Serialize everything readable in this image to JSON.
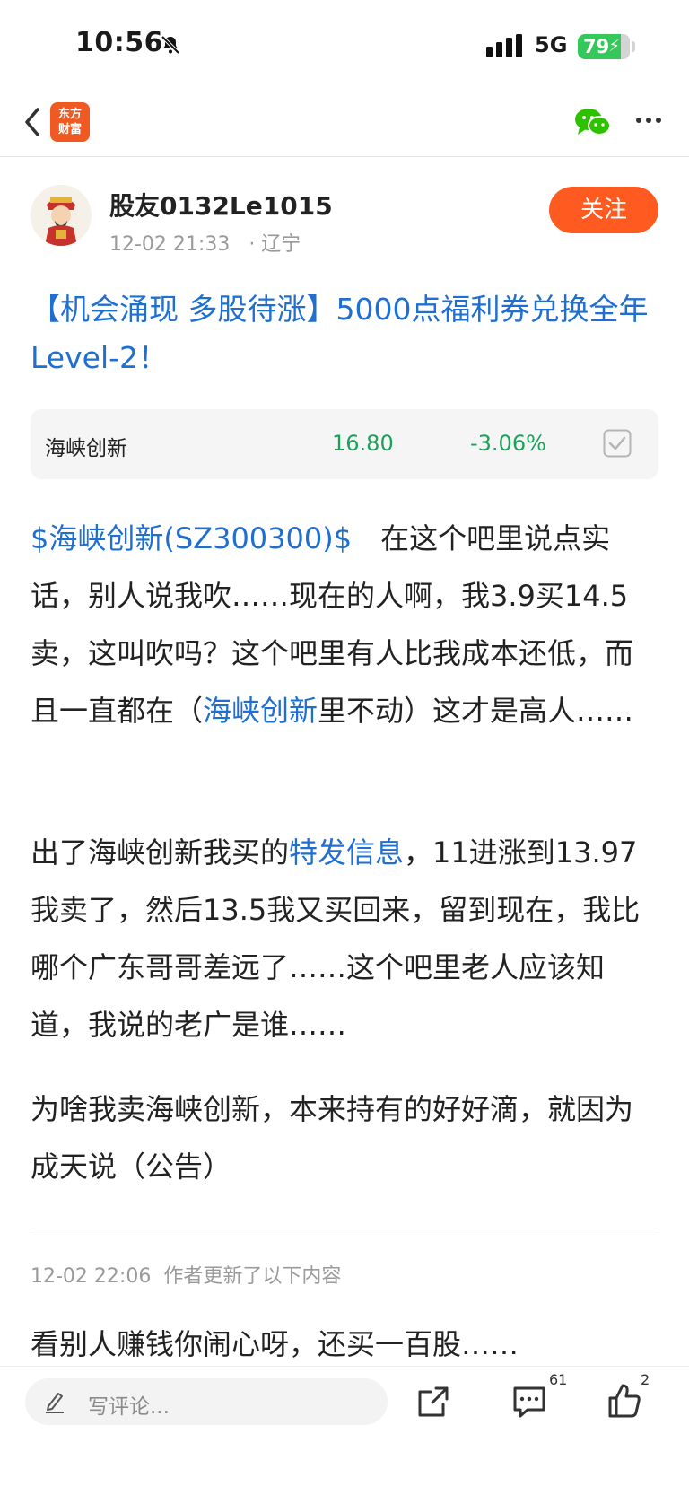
{
  "status_bar": {
    "time": "10:56",
    "network": "5G",
    "battery": "79"
  },
  "nav": {
    "logo_line1": "东方",
    "logo_line2": "财富"
  },
  "post": {
    "author": "股友0132Le1015",
    "datetime": "12-02 21:33",
    "location": "· 辽宁",
    "follow_label": "关注",
    "title": "【机会涌现 多股待涨】5000点福利券兑换全年Level-2！",
    "stock": {
      "name": "海峡创新",
      "price": "16.80",
      "change": "-3.06%"
    },
    "p1_link": "$海峡创新(SZ300300)$",
    "p1_a": "　在这个吧里说点实话，别人说我吹……现在的人啊，我3.9买14.5卖，这叫吹吗？这个吧里有人比我成本还低，而且一直都在（",
    "p1_link2": "海峡创新",
    "p1_b": "里不动）这才是高人……",
    "p2_a": "出了海峡创新我买的",
    "p2_link": "特发信息",
    "p2_b": "，11进涨到13.97我卖了，然后13.5我又买回来，留到现在，我比哪个广东哥哥差远了……这个吧里老人应该知道，我说的老广是谁……",
    "p3": "为啥我卖海峡创新，本来持有的好好滴，就因为成天说（公告）",
    "update_time": "12-02 22:06",
    "update_label": "作者更新了以下内容",
    "p4": "看别人赚钱你闹心呀，还买一百股……"
  },
  "bottom_bar": {
    "comment_placeholder": "写评论...",
    "comment_count": "61",
    "like_count": "2"
  },
  "colors": {
    "brand": "#f05a22",
    "follow": "#ff5a1f",
    "link": "#1f6fd1",
    "down_green": "#19a35a"
  }
}
